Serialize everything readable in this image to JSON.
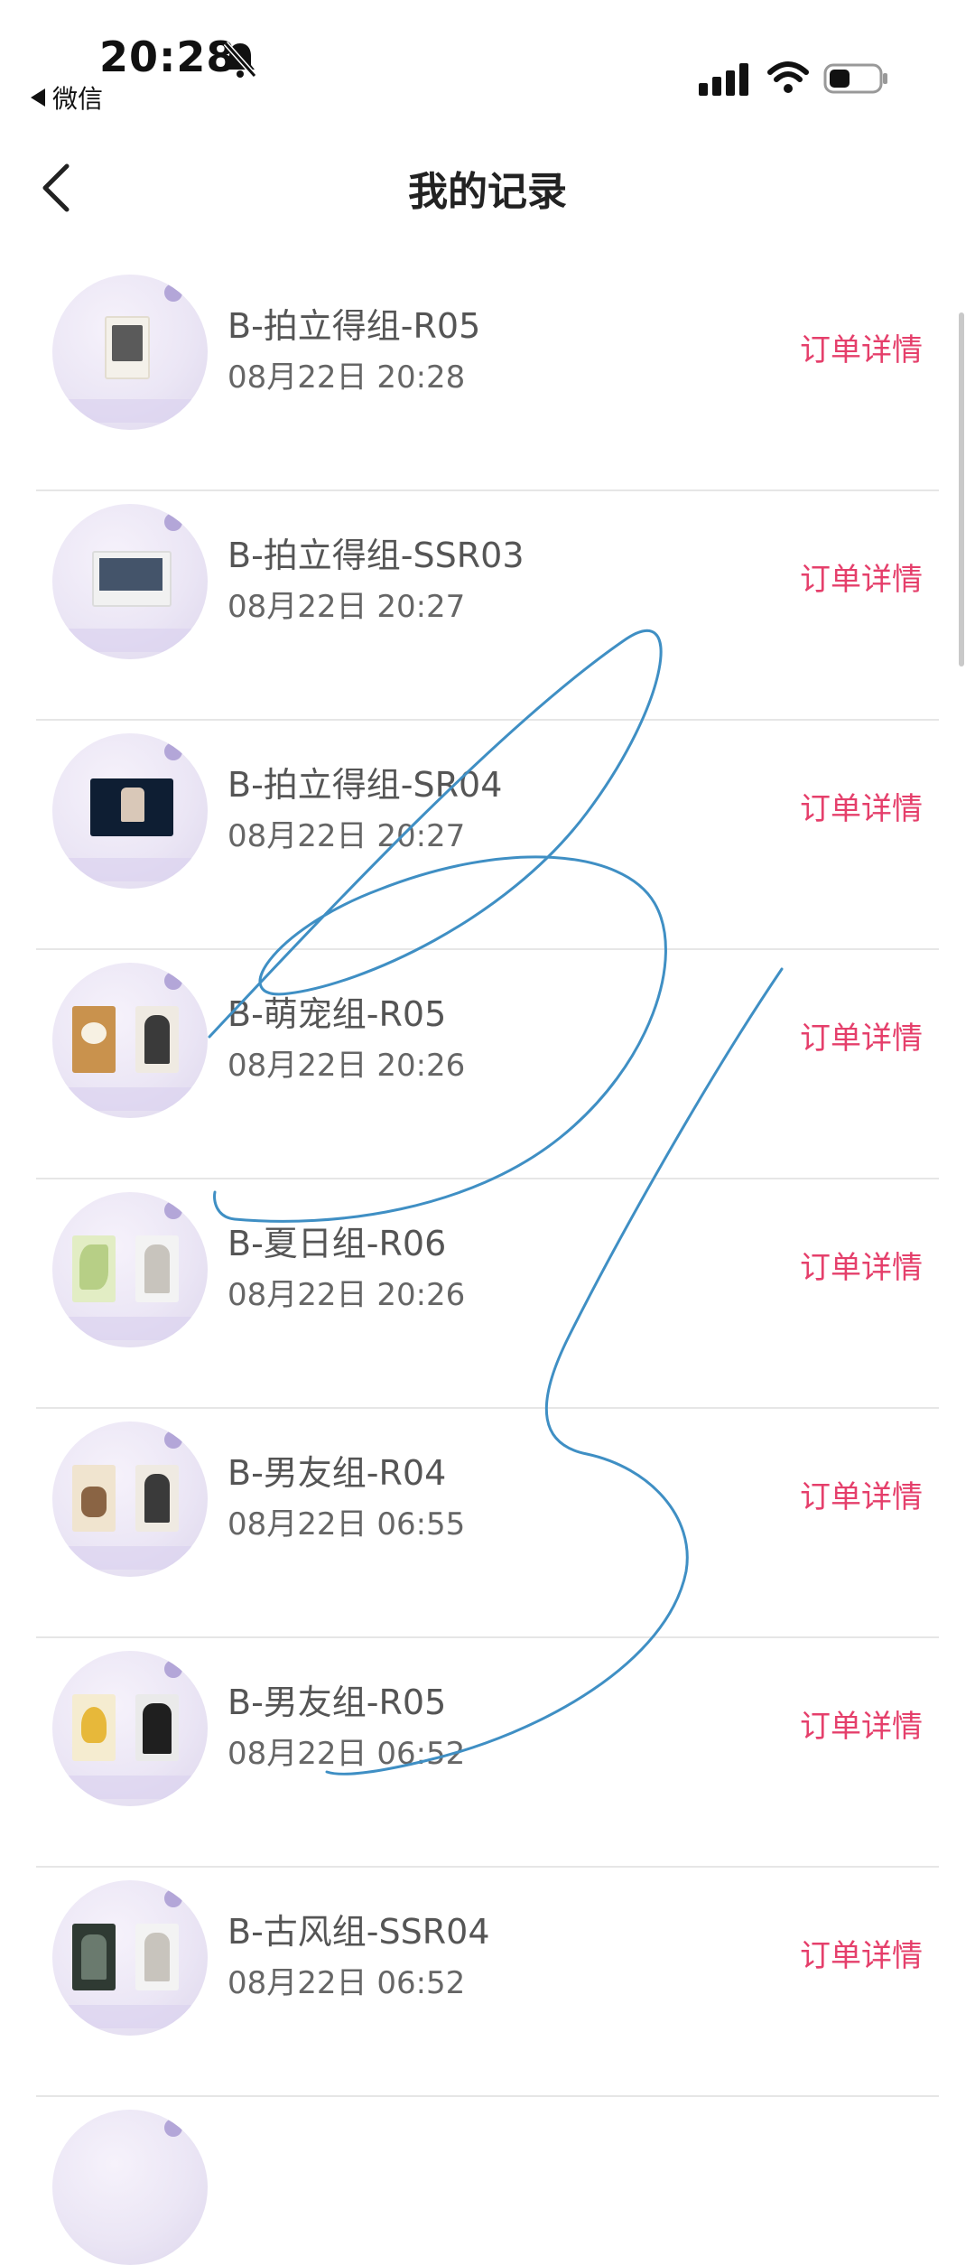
{
  "status_bar": {
    "time": "20:28",
    "back_app_label": "微信",
    "icons": [
      "bell-muted-icon",
      "signal-icon",
      "wifi-icon",
      "battery-icon"
    ]
  },
  "header": {
    "title": "我的记录",
    "back_icon": "chevron-left-icon"
  },
  "colors": {
    "accent": "#e53f6b",
    "text_primary": "#555555",
    "text_secondary": "#666666",
    "divider": "#e6e6e6",
    "scribble": "#3f8fc4"
  },
  "records": [
    {
      "name": "B-拍立得组-R05",
      "date": "08月22日 20:28",
      "action": "订单详情"
    },
    {
      "name": "B-拍立得组-SSR03",
      "date": "08月22日 20:27",
      "action": "订单详情"
    },
    {
      "name": "B-拍立得组-SR04",
      "date": "08月22日 20:27",
      "action": "订单详情"
    },
    {
      "name": "B-萌宠组-R05",
      "date": "08月22日 20:26",
      "action": "订单详情"
    },
    {
      "name": "B-夏日组-R06",
      "date": "08月22日 20:26",
      "action": "订单详情"
    },
    {
      "name": "B-男友组-R04",
      "date": "08月22日 06:55",
      "action": "订单详情"
    },
    {
      "name": "B-男友组-R05",
      "date": "08月22日 06:52",
      "action": "订单详情"
    },
    {
      "name": "B-古风组-SSR04",
      "date": "08月22日 06:52",
      "action": "订单详情"
    }
  ]
}
